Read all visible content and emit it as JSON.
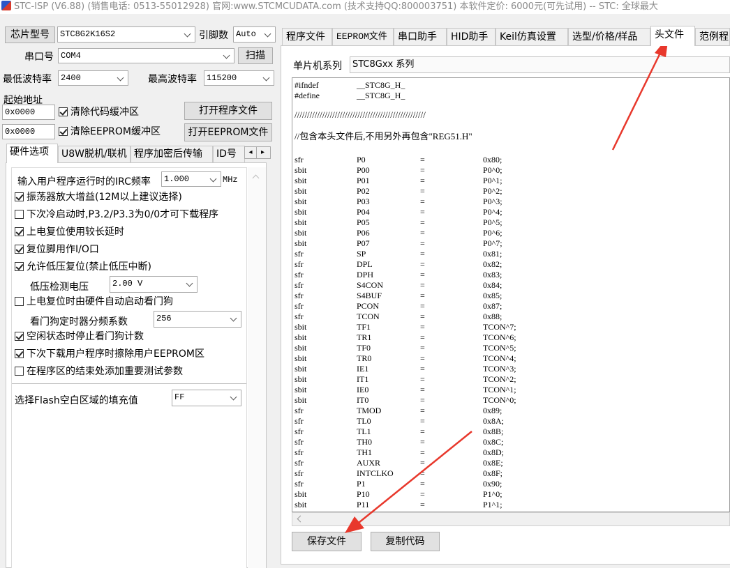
{
  "window": {
    "title": "STC-ISP (V6.88) (销售电话: 0513-55012928) 官网:www.STCMCUDATA.com  (技术支持QQ:800003751) 本软件定价: 6000元(可先试用) -- STC: 全球最大"
  },
  "left": {
    "chip_model_label": "芯片型号",
    "chip_model_value": "STC8G2K16S2",
    "pin_count_label": "引脚数",
    "pin_count_value": "Auto",
    "serial_port_label": "串口号",
    "serial_port_value": "COM4",
    "scan_button": "扫描",
    "min_baud_label": "最低波特率",
    "min_baud_value": "2400",
    "max_baud_label": "最高波特率",
    "max_baud_value": "115200",
    "start_address_label": "起始地址",
    "code_address_value": "0x0000",
    "clear_code_buffer": "清除代码缓冲区",
    "open_program_button": "打开程序文件",
    "eeprom_address_value": "0x0000",
    "clear_eeprom_buffer": "清除EEPROM缓冲区",
    "open_eeprom_button": "打开EEPROM文件",
    "tabs": [
      "硬件选项",
      "U8W脱机/联机",
      "程序加密后传输",
      "ID号"
    ],
    "tab_arrows": [
      "◂",
      "▸"
    ]
  },
  "hw_options": {
    "irc_label": "输入用户程序运行时的IRC频率",
    "irc_value": "1.000",
    "irc_unit": "MHz",
    "opt_oscillator_gain": "振荡器放大增益(12M以上建议选择)",
    "opt_cold_boot": "下次冷启动时,P3.2/P3.3为0/0才可下载程序",
    "opt_long_reset_delay": "上电复位使用较长延时",
    "opt_reset_as_io": "复位脚用作I/O口",
    "opt_low_voltage_reset": "允许低压复位(禁止低压中断)",
    "lv_detect_label": "低压检测电压",
    "lv_detect_value": "2.00 V",
    "opt_watchdog_auto": "上电复位时由硬件自动启动看门狗",
    "wdt_divider_label": "看门狗定时器分频系数",
    "wdt_divider_value": "256",
    "opt_idle_stop_wdt": "空闲状态时停止看门狗计数",
    "opt_erase_eeprom": "下次下载用户程序时擦除用户EEPROM区",
    "opt_add_test_params": "在程序区的结束处添加重要测试参数",
    "flash_fill_label": "选择Flash空白区域的填充值",
    "flash_fill_value": "FF",
    "checks": {
      "oscillator_gain": true,
      "cold_boot": false,
      "long_reset_delay": true,
      "reset_as_io": true,
      "low_voltage_reset": true,
      "watchdog_auto": false,
      "idle_stop_wdt": true,
      "erase_eeprom": true,
      "add_test_params": false
    }
  },
  "right": {
    "tabs": [
      "程序文件",
      "EEPROM文件",
      "串口助手",
      "HID助手",
      "Keil仿真设置",
      "选型/价格/样品",
      "头文件",
      "范例程"
    ],
    "active_tab": "头文件",
    "mcu_series_label": "单片机系列",
    "mcu_series_value": "STC8Gxx 系列",
    "save_button": "保存文件",
    "copy_button": "复制代码"
  },
  "code": {
    "header": [
      [
        "#ifndef",
        "__STC8G_H_"
      ],
      [
        "#define",
        "__STC8G_H_"
      ]
    ],
    "separator": "////////////////////////////////////////////////////",
    "comment": "//包含本头文件后,不用另外再包含\"REG51.H\"",
    "lines": [
      [
        "sfr",
        "P0",
        "=",
        "0x80;"
      ],
      [
        "sbit",
        "P00",
        "=",
        "P0^0;"
      ],
      [
        "sbit",
        "P01",
        "=",
        "P0^1;"
      ],
      [
        "sbit",
        "P02",
        "=",
        "P0^2;"
      ],
      [
        "sbit",
        "P03",
        "=",
        "P0^3;"
      ],
      [
        "sbit",
        "P04",
        "=",
        "P0^4;"
      ],
      [
        "sbit",
        "P05",
        "=",
        "P0^5;"
      ],
      [
        "sbit",
        "P06",
        "=",
        "P0^6;"
      ],
      [
        "sbit",
        "P07",
        "=",
        "P0^7;"
      ],
      [
        "sfr",
        "SP",
        "=",
        "0x81;"
      ],
      [
        "sfr",
        "DPL",
        "=",
        "0x82;"
      ],
      [
        "sfr",
        "DPH",
        "=",
        "0x83;"
      ],
      [
        "sfr",
        "S4CON",
        "=",
        "0x84;"
      ],
      [
        "sfr",
        "S4BUF",
        "=",
        "0x85;"
      ],
      [
        "sfr",
        "PCON",
        "=",
        "0x87;"
      ],
      [
        "sfr",
        "TCON",
        "=",
        "0x88;"
      ],
      [
        "sbit",
        "TF1",
        "=",
        "TCON^7;"
      ],
      [
        "sbit",
        "TR1",
        "=",
        "TCON^6;"
      ],
      [
        "sbit",
        "TF0",
        "=",
        "TCON^5;"
      ],
      [
        "sbit",
        "TR0",
        "=",
        "TCON^4;"
      ],
      [
        "sbit",
        "IE1",
        "=",
        "TCON^3;"
      ],
      [
        "sbit",
        "IT1",
        "=",
        "TCON^2;"
      ],
      [
        "sbit",
        "IE0",
        "=",
        "TCON^1;"
      ],
      [
        "sbit",
        "IT0",
        "=",
        "TCON^0;"
      ],
      [
        "sfr",
        "TMOD",
        "=",
        "0x89;"
      ],
      [
        "sfr",
        "TL0",
        "=",
        "0x8A;"
      ],
      [
        "sfr",
        "TL1",
        "=",
        "0x8B;"
      ],
      [
        "sfr",
        "TH0",
        "=",
        "0x8C;"
      ],
      [
        "sfr",
        "TH1",
        "=",
        "0x8D;"
      ],
      [
        "sfr",
        "AUXR",
        "=",
        "0x8E;"
      ],
      [
        "sfr",
        "INTCLKO",
        "=",
        "0x8F;"
      ],
      [
        "sfr",
        "P1",
        "=",
        "0x90;"
      ],
      [
        "sbit",
        "P10",
        "=",
        "P1^0;"
      ],
      [
        "sbit",
        "P11",
        "=",
        "P1^1;"
      ]
    ]
  },
  "colors": {
    "annotation_arrow": "#e8382c"
  }
}
